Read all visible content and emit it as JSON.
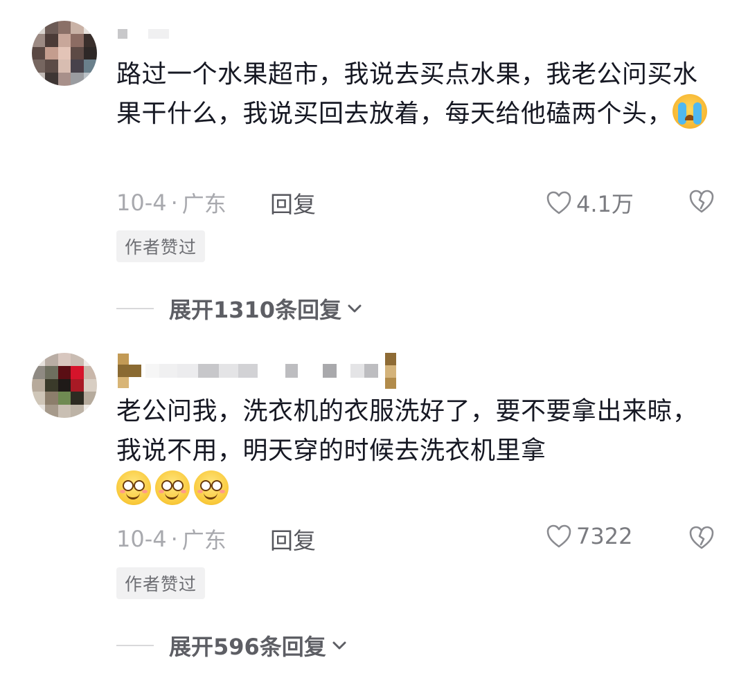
{
  "comments": [
    {
      "text": "路过一个水果超市，我说去买点水果，我老公问买水果干什么，我说买回去放着，每天给他磕两个头，",
      "emoji": "crying-face-emoji",
      "date": "10-4",
      "separator": "·",
      "location": "广东",
      "reply_label": "回复",
      "likes": "4.1万",
      "badge": "作者赞过",
      "expand_label": "展开1310条回复"
    },
    {
      "text": "老公问我，洗衣机的衣服洗好了，要不要拿出来晾，我说不用，明天穿的时候去洗衣机里拿",
      "emoji": "smiling-face-emoji",
      "emoji_count": 3,
      "date": "10-4",
      "separator": "·",
      "location": "广东",
      "reply_label": "回复",
      "likes": "7322",
      "badge": "作者赞过",
      "expand_label": "展开596条回复"
    }
  ],
  "icons": {
    "like": "heart-outline-icon",
    "dislike": "broken-heart-icon",
    "expand": "chevron-down-icon"
  },
  "colors": {
    "text": "#161823",
    "meta": "#a8a9ae",
    "badge_bg": "#f1f1f2"
  }
}
